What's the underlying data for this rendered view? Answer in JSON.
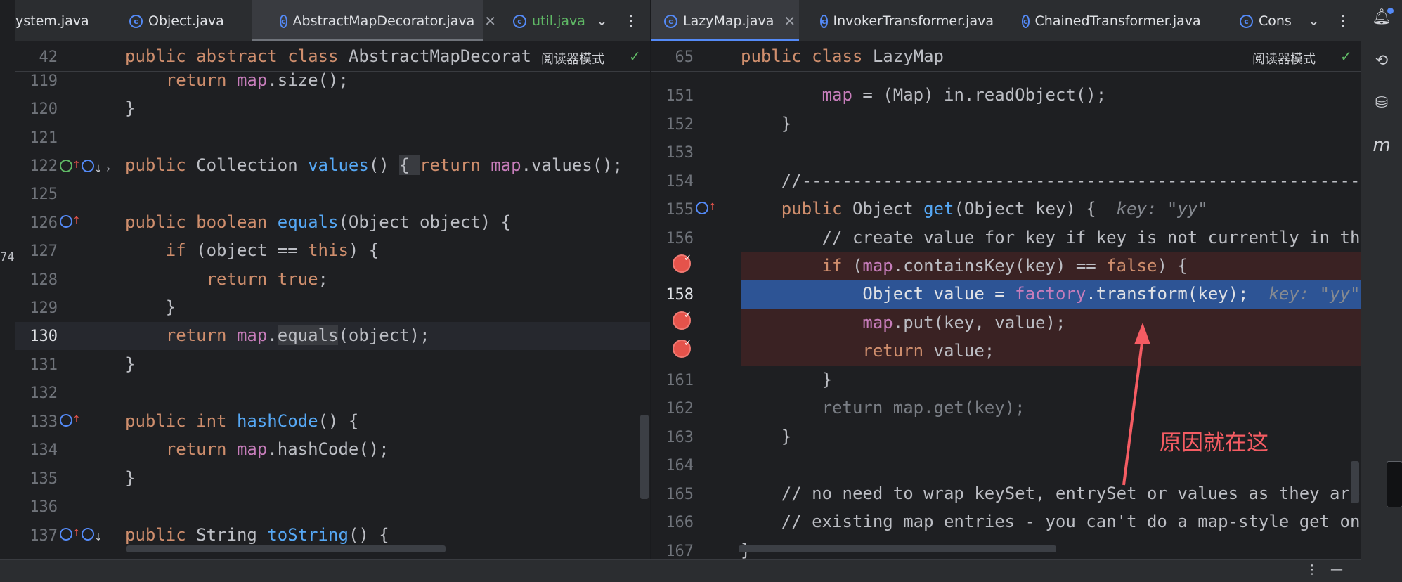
{
  "left_tabs": [
    {
      "label": "ystem.java",
      "active": false
    },
    {
      "label": "Object.java",
      "active": false
    },
    {
      "label": "AbstractMapDecorator.java",
      "active": true
    },
    {
      "label": "util.java",
      "active": false
    }
  ],
  "right_tabs": [
    {
      "label": "LazyMap.java",
      "active": true
    },
    {
      "label": "InvokerTransformer.java",
      "active": false
    },
    {
      "label": "ChainedTransformer.java",
      "active": false
    },
    {
      "label": "Cons",
      "active": false
    }
  ],
  "left_editor": {
    "sticky_line": "42",
    "sticky_kw": "public abstract class ",
    "sticky_name": "AbstractMapDecorat",
    "reader_mode": "阅读器模式",
    "lines": [
      {
        "n": "119"
      },
      {
        "n": "120"
      },
      {
        "n": "121"
      },
      {
        "n": "122"
      },
      {
        "n": "125"
      },
      {
        "n": "126"
      },
      {
        "n": "127"
      },
      {
        "n": "128"
      },
      {
        "n": "129"
      },
      {
        "n": "130"
      },
      {
        "n": "131"
      },
      {
        "n": "132"
      },
      {
        "n": "133"
      },
      {
        "n": "134"
      },
      {
        "n": "135"
      },
      {
        "n": "136"
      },
      {
        "n": "137"
      }
    ]
  },
  "right_editor": {
    "sticky_line": "65",
    "sticky_kw": "public class ",
    "sticky_name": "LazyMap",
    "reader_mode": "阅读器模式",
    "lines": [
      {
        "n": "151"
      },
      {
        "n": "152"
      },
      {
        "n": "153"
      },
      {
        "n": "154"
      },
      {
        "n": "155"
      },
      {
        "n": "156"
      },
      {
        "n": ""
      },
      {
        "n": "158"
      },
      {
        "n": ""
      },
      {
        "n": ""
      },
      {
        "n": "161"
      },
      {
        "n": "162"
      },
      {
        "n": "163"
      },
      {
        "n": "164"
      },
      {
        "n": "165"
      },
      {
        "n": "166"
      },
      {
        "n": "167"
      }
    ],
    "hint_key": "key: \"yy\""
  },
  "left_edge_number": "74",
  "annotation": "原因就在这",
  "colors": {
    "accent": "#548af7",
    "breakpoint": "#e5534b",
    "annotation": "#f55c63"
  },
  "icons": [
    "bell-icon",
    "ai-assistant-icon",
    "database-icon",
    "maven-icon"
  ]
}
